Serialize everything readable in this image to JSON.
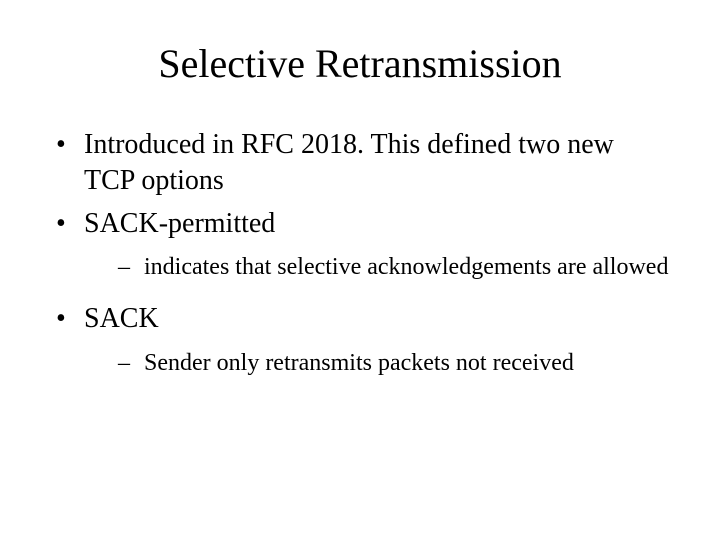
{
  "title": "Selective Retransmission",
  "bullets": [
    {
      "text": "Introduced in RFC 2018. This defined two new TCP options",
      "sub": []
    },
    {
      "text": "SACK-permitted",
      "sub": [
        {
          "text": "indicates that selective acknowledgements are allowed"
        }
      ]
    },
    {
      "text": "SACK",
      "sub": [
        {
          "text": "Sender only retransmits packets not received"
        }
      ]
    }
  ]
}
